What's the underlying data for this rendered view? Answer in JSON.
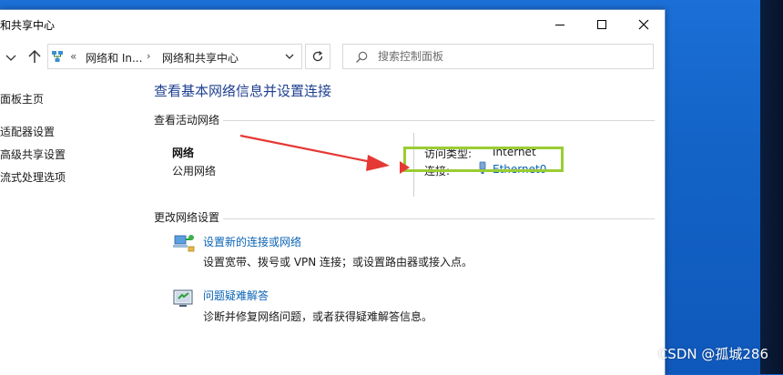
{
  "window": {
    "title": "和共享中心"
  },
  "address_bar": {
    "chevron": "«",
    "crumb_1": "网络和 In...",
    "separator": "›",
    "crumb_2": "网络和共享中心"
  },
  "search": {
    "placeholder": "搜索控制面板"
  },
  "left_pane": {
    "items": [
      "面板主页",
      "适配器设置",
      "高级共享设置",
      "流式处理选项"
    ]
  },
  "main": {
    "title": "查看基本网络信息并设置连接",
    "active_networks_heading": "查看活动网络",
    "network": {
      "name": "网络",
      "type": "公用网络",
      "access_type_label": "访问类型:",
      "access_type_value": "Internet",
      "connection_label": "连接:",
      "connection_value": "Ethernet0"
    },
    "change_settings_heading": "更改网络设置",
    "tasks": [
      {
        "link": "设置新的连接或网络",
        "description": "设置宽带、拨号或 VPN 连接；或设置路由器或接入点。",
        "icon": "network-setup-icon"
      },
      {
        "link": "问题疑难解答",
        "description": "诊断并修复网络问题，或者获得疑难解答信息。",
        "icon": "troubleshoot-icon"
      }
    ]
  },
  "annotation": {
    "arrow_color": "#e53935",
    "highlight_color": "#9acd32"
  },
  "watermark": "CSDN @孤城286",
  "colors": {
    "link": "#0b63b6",
    "title": "#1e3f8f",
    "desktop": "#1460c8"
  }
}
